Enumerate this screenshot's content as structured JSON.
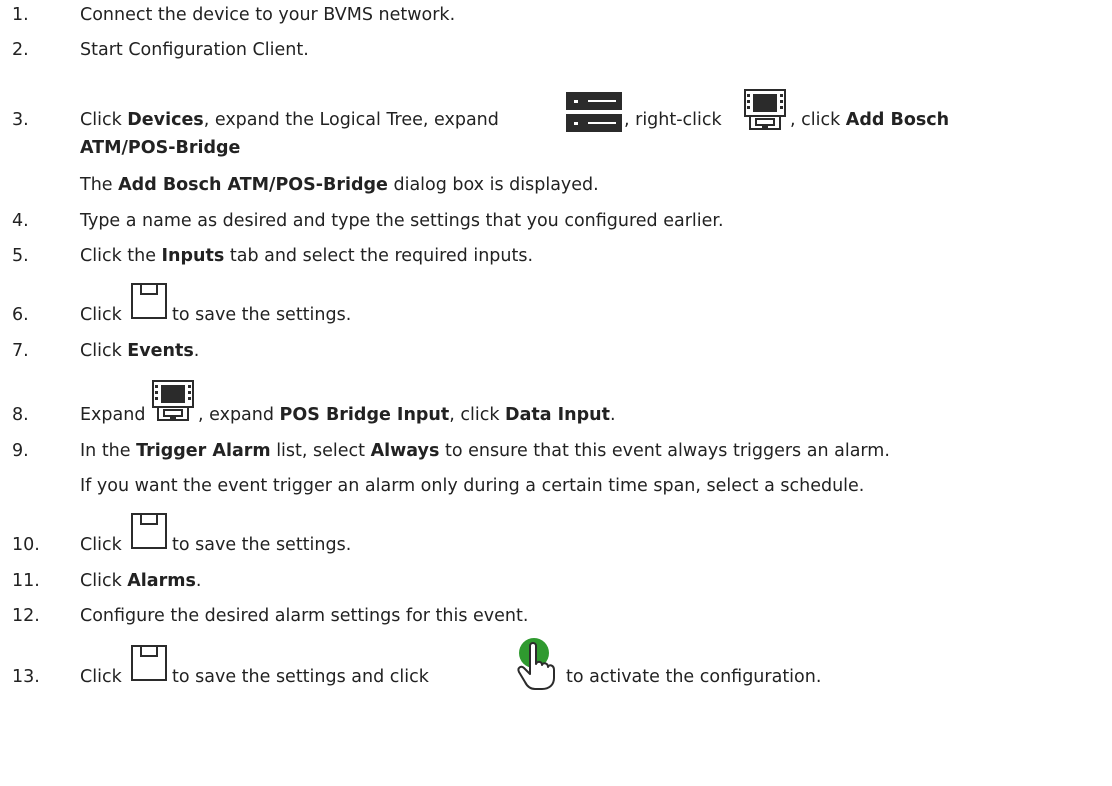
{
  "steps": [
    {
      "num": "1.",
      "text": "Connect the device to your BVMS network."
    },
    {
      "num": "2.",
      "text": "Start Configuration Client."
    },
    {
      "num": "3.",
      "p1": "Click ",
      "b1": "Devices",
      "p2": ", expand the Logical Tree, expand ",
      "p3": ", right-click ",
      "p4": ", click ",
      "b2": "Add Bosch",
      "b3": "ATM/POS-Bridge",
      "p5": ".",
      "sub_p1": "The ",
      "sub_b1": "Add Bosch ATM/POS-Bridge",
      "sub_p2": " dialog box is displayed."
    },
    {
      "num": "4.",
      "text": "Type a name as desired and type the settings that you configured earlier."
    },
    {
      "num": "5.",
      "p1": "Click the ",
      "b1": "Inputs",
      "p2": " tab and select the required inputs."
    },
    {
      "num": "6.",
      "p1": "Click ",
      "p2": " to save the settings."
    },
    {
      "num": "7.",
      "p1": "Click ",
      "b1": "Events",
      "p2": "."
    },
    {
      "num": "8.",
      "p1": "Expand ",
      "p2": ", expand ",
      "b1": "POS Bridge Input",
      "p3": ", click ",
      "b2": "Data Input",
      "p4": "."
    },
    {
      "num": "9.",
      "p1": "In the ",
      "b1": "Trigger Alarm",
      "p2": " list, select ",
      "b2": "Always",
      "p3": " to ensure that this event always triggers an alarm.",
      "sub": "If you want the event trigger an alarm only during a certain time span, select a schedule."
    },
    {
      "num": "10.",
      "p1": "Click ",
      "p2": " to save the settings."
    },
    {
      "num": "11.",
      "p1": "Click ",
      "b1": "Alarms",
      "p2": "."
    },
    {
      "num": "12.",
      "text": "Configure the desired alarm settings for this event."
    },
    {
      "num": "13.",
      "p1": "Click ",
      "p2": " to save the settings and click ",
      "p3": " to activate the configuration."
    }
  ],
  "icons": {
    "server": "server-icon",
    "atm_pos": "atm-pos-bridge-icon",
    "save": "save-icon",
    "activate": "activate-hand-icon"
  },
  "colors": {
    "text": "#222222",
    "icon_dark": "#2b2b2b",
    "activate_green": "#2f9a2f"
  }
}
